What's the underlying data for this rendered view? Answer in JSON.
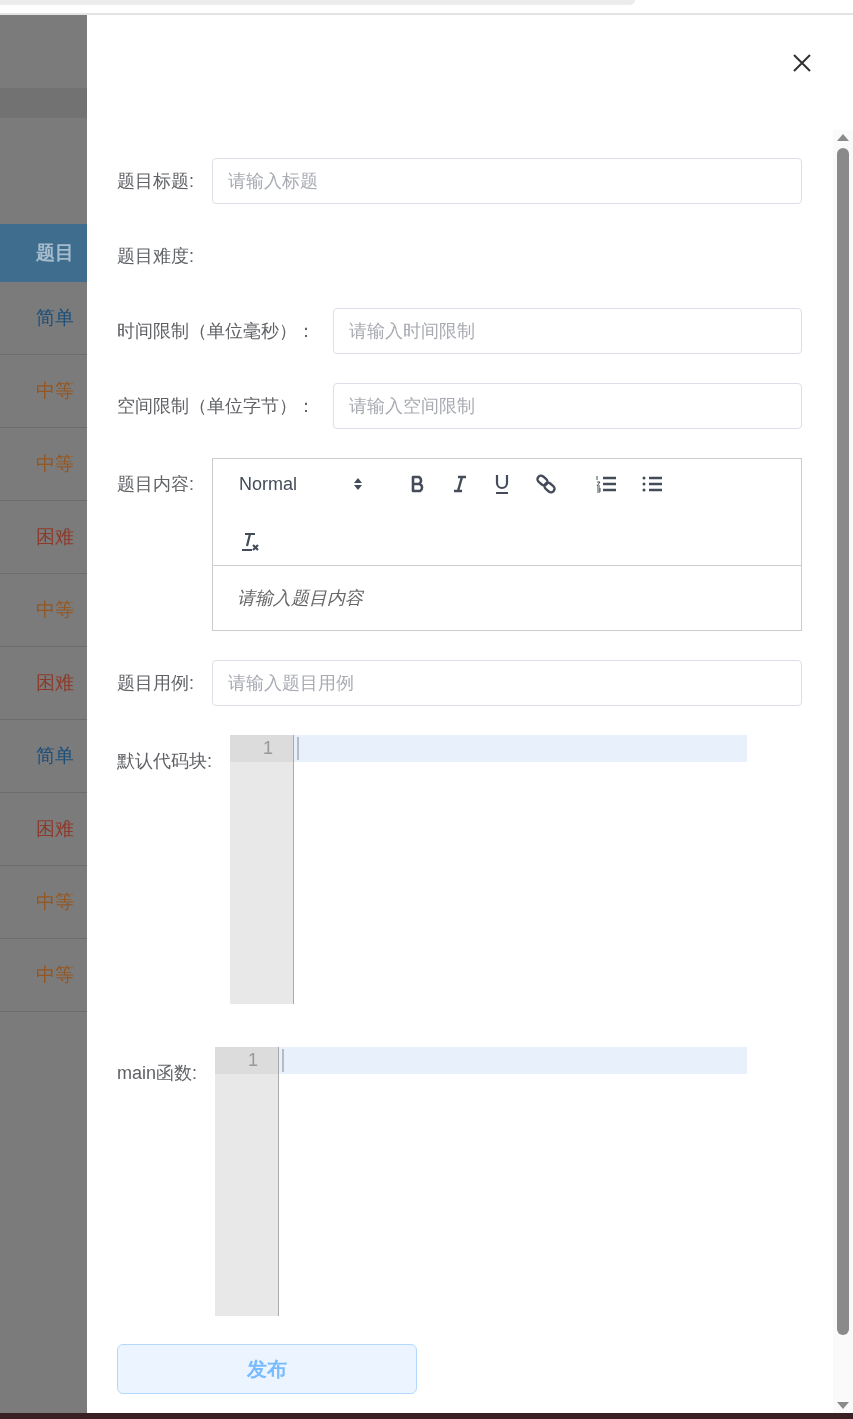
{
  "background_table": {
    "header": "题目",
    "rows": [
      {
        "difficulty": "简单",
        "color": "#1d4f7c"
      },
      {
        "difficulty": "中等",
        "color": "#96561f"
      },
      {
        "difficulty": "中等",
        "color": "#96561f"
      },
      {
        "difficulty": "困难",
        "color": "#8c3b2b"
      },
      {
        "difficulty": "中等",
        "color": "#96561f"
      },
      {
        "difficulty": "困难",
        "color": "#8c3b2b"
      },
      {
        "difficulty": "简单",
        "color": "#1d4f7c"
      },
      {
        "difficulty": "困难",
        "color": "#8c3b2b"
      },
      {
        "difficulty": "中等",
        "color": "#96561f"
      },
      {
        "difficulty": "中等",
        "color": "#96561f"
      }
    ]
  },
  "form": {
    "fields": [
      {
        "kind": "input",
        "label": "题目标题:",
        "placeholder": "请输入标题"
      },
      {
        "kind": "text",
        "label": "题目难度:"
      },
      {
        "kind": "input",
        "label": "时间限制（单位毫秒）：",
        "placeholder": "请输入时间限制"
      },
      {
        "kind": "input",
        "label": "空间限制（单位字节）：",
        "placeholder": "请输入空间限制"
      },
      {
        "kind": "rich_editor",
        "label": "题目内容:",
        "format": "Normal",
        "placeholder": "请输入题目内容"
      },
      {
        "kind": "input",
        "label": "题目用例:",
        "placeholder": "请输入题目用例"
      },
      {
        "kind": "code",
        "label": "默认代码块:",
        "line_numbers": [
          "1"
        ]
      },
      {
        "kind": "code",
        "label": "main函数:",
        "line_numbers": [
          "1"
        ]
      }
    ]
  },
  "submit": "发布"
}
